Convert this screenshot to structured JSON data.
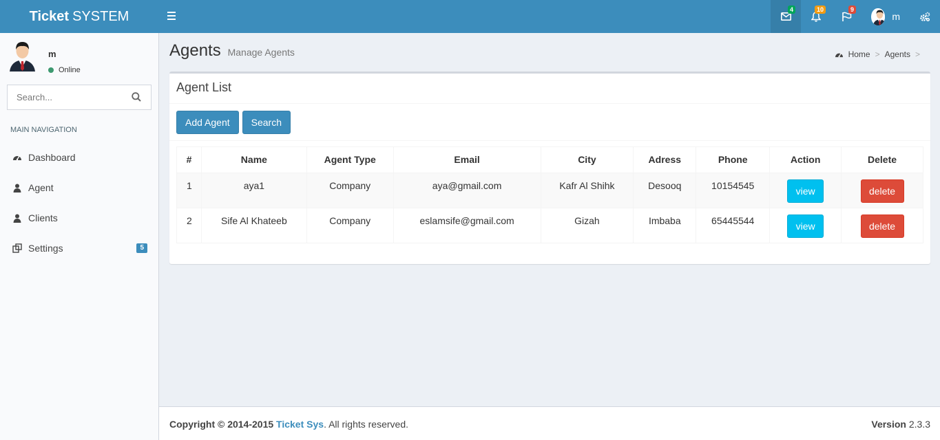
{
  "logo": {
    "bold": "Ticket",
    "rest": "SYSTEM"
  },
  "header": {
    "messages_count": "4",
    "notifications_count": "10",
    "flags_count": "9",
    "user_name": "m"
  },
  "sidebar": {
    "user_name": "m",
    "status": "Online",
    "search_placeholder": "Search...",
    "nav_header": "MAIN NAVIGATION",
    "items": [
      {
        "label": "Dashboard",
        "icon": "dashboard-icon"
      },
      {
        "label": "Agent",
        "icon": "user-icon"
      },
      {
        "label": "Clients",
        "icon": "user-icon"
      },
      {
        "label": "Settings",
        "icon": "settings-icon",
        "badge": "5"
      }
    ]
  },
  "page": {
    "title": "Agents",
    "subtitle": "Manage Agents",
    "breadcrumb": {
      "home": "Home",
      "current": "Agents"
    }
  },
  "box": {
    "title": "Agent List",
    "add_button": "Add Agent",
    "search_button": "Search"
  },
  "table": {
    "headers": [
      "#",
      "Name",
      "Agent Type",
      "Email",
      "City",
      "Adress",
      "Phone",
      "Action",
      "Delete"
    ],
    "rows": [
      {
        "num": "1",
        "name": "aya1",
        "type": "Company",
        "email": "aya@gmail.com",
        "city": "Kafr Al Shihk",
        "address": "Desooq",
        "phone": "10154545",
        "view": "view",
        "delete": "delete"
      },
      {
        "num": "2",
        "name": "Sife Al Khateeb",
        "type": "Company",
        "email": "eslamsife@gmail.com",
        "city": "Gizah",
        "address": "Imbaba",
        "phone": "65445544",
        "view": "view",
        "delete": "delete"
      }
    ]
  },
  "footer": {
    "copyright": "Copyright © 2014-2015",
    "brand": "Ticket Sys",
    "rights": ". All rights reserved.",
    "version_label": "Version",
    "version": "2.3.3"
  },
  "colors": {
    "header": "#3c8dbc",
    "primary": "#3c8dbc",
    "info": "#00c0ef",
    "danger": "#dd4b39"
  }
}
